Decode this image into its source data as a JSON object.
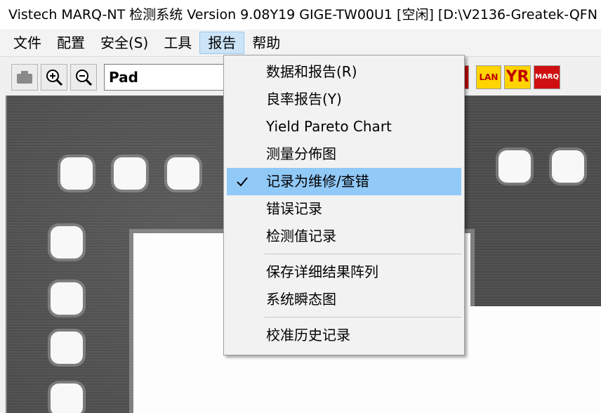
{
  "window": {
    "title": "Vistech MARQ-NT 检测系统 Version 9.08Y19 GIGE-TW00U1 [空闲] [D:\\V2136-Greatek-QFN"
  },
  "menubar": {
    "items": [
      {
        "label": "文件"
      },
      {
        "label": "配置"
      },
      {
        "label": "安全(S)"
      },
      {
        "label": "工具"
      },
      {
        "label": "报告"
      },
      {
        "label": "帮助"
      }
    ]
  },
  "toolbar": {
    "combo_value": "Pad",
    "right_icons": [
      {
        "label": "LAN",
        "color": "#c00000",
        "bg": "#ffd400"
      },
      {
        "label": "YR",
        "color": "#c00000",
        "bg": "#ffd400"
      },
      {
        "label": "MARQ",
        "color": "#ffffff",
        "bg": "#d01010"
      }
    ]
  },
  "report_menu": {
    "items": [
      {
        "label": "数据和报告(R)"
      },
      {
        "label": "良率报告(Y)"
      },
      {
        "label": "Yield Pareto Chart"
      },
      {
        "label": "测量分佈图"
      },
      {
        "label": "记录为维修/查错",
        "checked": true
      },
      {
        "label": "错误记录"
      },
      {
        "label": "检测值记录"
      },
      {
        "label": "保存详细结果阵列"
      },
      {
        "label": "系统瞬态图"
      },
      {
        "label": "校准历史记录"
      }
    ]
  },
  "colors": {
    "menu_highlight": "#91c9f7",
    "active_menu": "#cce4f7"
  }
}
